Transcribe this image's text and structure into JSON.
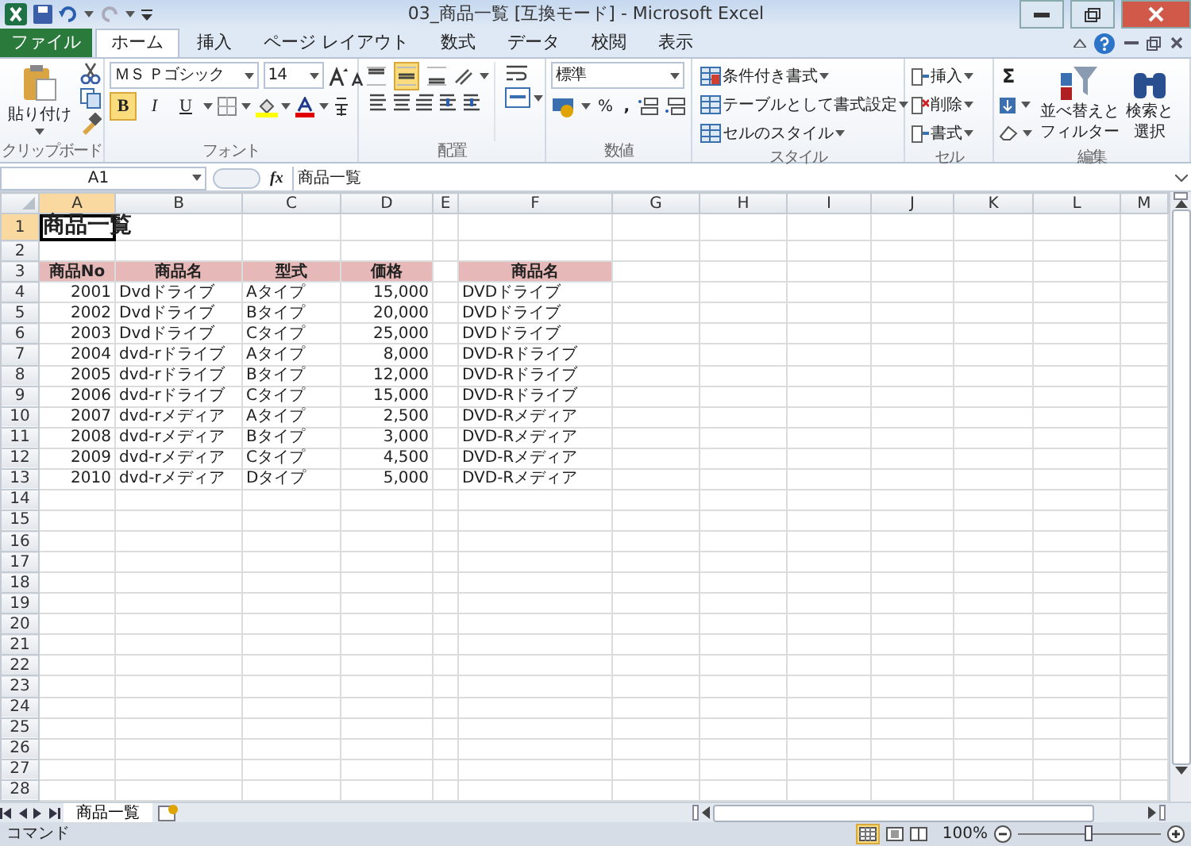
{
  "window": {
    "title": "03_商品一覧 [互換モード] - Microsoft Excel"
  },
  "tabs": [
    {
      "label": "ファイル",
      "kind": "file",
      "selected": false
    },
    {
      "label": "ホーム",
      "kind": "tab",
      "selected": true
    },
    {
      "label": "挿入",
      "kind": "tab",
      "selected": false
    },
    {
      "label": "ページ レイアウト",
      "kind": "tab",
      "selected": false
    },
    {
      "label": "数式",
      "kind": "tab",
      "selected": false
    },
    {
      "label": "データ",
      "kind": "tab",
      "selected": false
    },
    {
      "label": "校閲",
      "kind": "tab",
      "selected": false
    },
    {
      "label": "表示",
      "kind": "tab",
      "selected": false
    }
  ],
  "ribbon": {
    "clipboard": {
      "label": "クリップボード",
      "paste": "貼り付け"
    },
    "font": {
      "label": "フォント",
      "font_name": "ＭＳ Ｐゴシック",
      "font_size": "14",
      "styles": [
        {
          "text": "B",
          "selected": true
        },
        {
          "text": "I",
          "selected": false
        },
        {
          "text": "U",
          "selected": false
        }
      ]
    },
    "alignment": {
      "label": "配置",
      "vertical": [
        {
          "selected": false
        },
        {
          "selected": true
        },
        {
          "selected": false
        }
      ]
    },
    "number": {
      "label": "数値",
      "format": "標準",
      "percent": "%",
      "comma": ","
    },
    "styles": {
      "label": "スタイル",
      "commands": [
        "条件付き書式",
        "テーブルとして書式設定",
        "セルのスタイル"
      ]
    },
    "cells": {
      "label": "セル",
      "commands": [
        "挿入",
        "削除",
        "書式"
      ]
    },
    "editing": {
      "label": "編集",
      "sum": "Σ",
      "sort": "並べ替えと",
      "sort_2": "フィルター",
      "find": "検索と",
      "find_2": "選択"
    }
  },
  "formula_bar": {
    "name_box": "A1",
    "fx": "fx",
    "content": "商品一覧"
  },
  "sheet": {
    "columns": [
      {
        "letter": "A",
        "selected": true
      },
      {
        "letter": "B",
        "selected": false
      },
      {
        "letter": "C",
        "selected": false
      },
      {
        "letter": "D",
        "selected": false
      },
      {
        "letter": "E",
        "selected": false
      },
      {
        "letter": "F",
        "selected": false
      },
      {
        "letter": "G",
        "selected": false
      },
      {
        "letter": "H",
        "selected": false
      },
      {
        "letter": "I",
        "selected": false
      },
      {
        "letter": "J",
        "selected": false
      },
      {
        "letter": "K",
        "selected": false
      },
      {
        "letter": "L",
        "selected": false
      },
      {
        "letter": "M",
        "selected": false
      }
    ],
    "rows": [
      {
        "number": "1",
        "kind": "title",
        "selected": true,
        "cells": [
          "商品一覧"
        ]
      },
      {
        "number": "2",
        "kind": "data",
        "selected": false,
        "cells": []
      },
      {
        "number": "3",
        "kind": "header",
        "selected": false,
        "cells": [
          "商品No",
          "商品名",
          "型式",
          "価格",
          "",
          "商品名"
        ]
      },
      {
        "number": "4",
        "kind": "data",
        "selected": false,
        "cells": [
          "2001",
          "Dvdドライブ",
          "Aタイプ",
          "15,000",
          "",
          "DVDドライブ"
        ]
      },
      {
        "number": "5",
        "kind": "data",
        "selected": false,
        "cells": [
          "2002",
          "Dvdドライブ",
          "Bタイプ",
          "20,000",
          "",
          "DVDドライブ"
        ]
      },
      {
        "number": "6",
        "kind": "data",
        "selected": false,
        "cells": [
          "2003",
          "Dvdドライブ",
          "Cタイプ",
          "25,000",
          "",
          "DVDドライブ"
        ]
      },
      {
        "number": "7",
        "kind": "data",
        "selected": false,
        "cells": [
          "2004",
          "dvd-rドライブ",
          "Aタイプ",
          "8,000",
          "",
          "DVD-Rドライブ"
        ]
      },
      {
        "number": "8",
        "kind": "data",
        "selected": false,
        "cells": [
          "2005",
          "dvd-rドライブ",
          "Bタイプ",
          "12,000",
          "",
          "DVD-Rドライブ"
        ]
      },
      {
        "number": "9",
        "kind": "data",
        "selected": false,
        "cells": [
          "2006",
          "dvd-rドライブ",
          "Cタイプ",
          "15,000",
          "",
          "DVD-Rドライブ"
        ]
      },
      {
        "number": "10",
        "kind": "data",
        "selected": false,
        "cells": [
          "2007",
          "dvd-rメディア",
          "Aタイプ",
          "2,500",
          "",
          "DVD-Rメディア"
        ]
      },
      {
        "number": "11",
        "kind": "data",
        "selected": false,
        "cells": [
          "2008",
          "dvd-rメディア",
          "Bタイプ",
          "3,000",
          "",
          "DVD-Rメディア"
        ]
      },
      {
        "number": "12",
        "kind": "data",
        "selected": false,
        "cells": [
          "2009",
          "dvd-rメディア",
          "Cタイプ",
          "4,500",
          "",
          "DVD-Rメディア"
        ]
      },
      {
        "number": "13",
        "kind": "data",
        "selected": false,
        "cells": [
          "2010",
          "dvd-rメディア",
          "Dタイプ",
          "5,000",
          "",
          "DVD-Rメディア"
        ]
      },
      {
        "number": "14",
        "kind": "data",
        "selected": false,
        "cells": []
      },
      {
        "number": "15",
        "kind": "data",
        "selected": false,
        "cells": []
      },
      {
        "number": "16",
        "kind": "data",
        "selected": false,
        "cells": []
      },
      {
        "number": "17",
        "kind": "data",
        "selected": false,
        "cells": []
      },
      {
        "number": "18",
        "kind": "data",
        "selected": false,
        "cells": []
      },
      {
        "number": "19",
        "kind": "data",
        "selected": false,
        "cells": []
      },
      {
        "number": "20",
        "kind": "data",
        "selected": false,
        "cells": []
      },
      {
        "number": "21",
        "kind": "data",
        "selected": false,
        "cells": []
      },
      {
        "number": "22",
        "kind": "data",
        "selected": false,
        "cells": []
      },
      {
        "number": "23",
        "kind": "data",
        "selected": false,
        "cells": []
      },
      {
        "number": "24",
        "kind": "data",
        "selected": false,
        "cells": []
      },
      {
        "number": "25",
        "kind": "data",
        "selected": false,
        "cells": []
      },
      {
        "number": "26",
        "kind": "data",
        "selected": false,
        "cells": []
      },
      {
        "number": "27",
        "kind": "data",
        "selected": false,
        "cells": []
      },
      {
        "number": "28",
        "kind": "data",
        "selected": false,
        "cells": []
      }
    ]
  },
  "sheet_tabs": [
    {
      "label": "商品一覧",
      "selected": true
    }
  ],
  "status_bar": {
    "mode": "コマンド",
    "zoom": "100%",
    "zoom_slider": {
      "level": 0.5
    }
  }
}
